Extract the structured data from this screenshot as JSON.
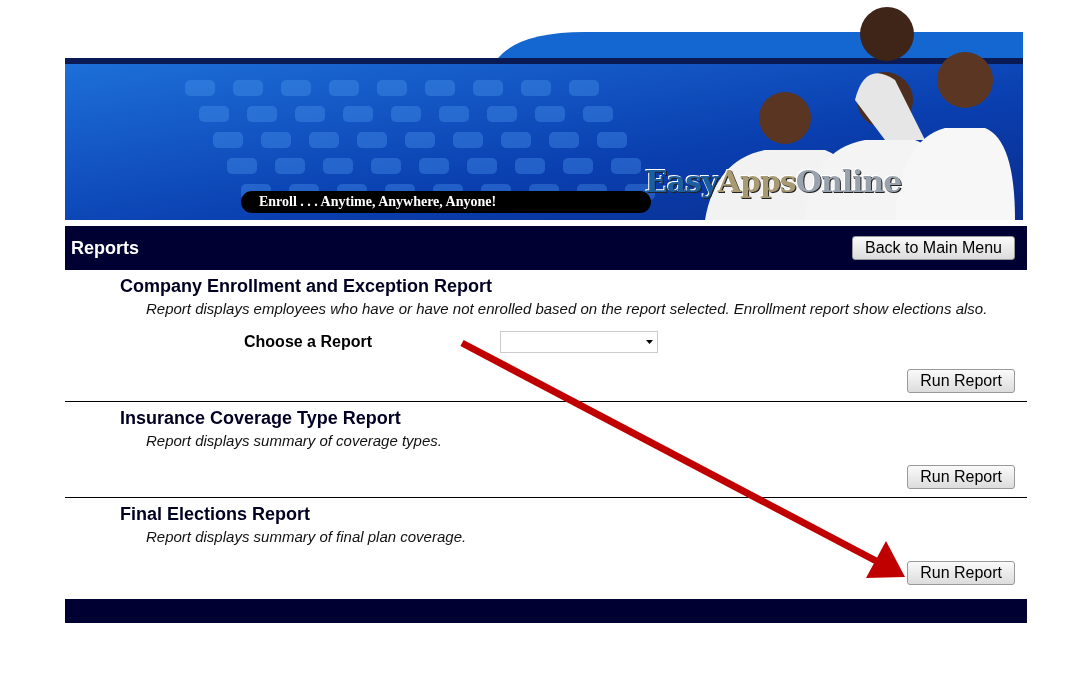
{
  "banner": {
    "tagline": "Enroll . . . Anytime, Anywhere, Anyone!",
    "logo": [
      {
        "text": "Easy",
        "color": "#1d5f9e"
      },
      {
        "text": "Apps",
        "color": "#a89a72"
      },
      {
        "text": "Online",
        "color": "#9aa3ad"
      }
    ]
  },
  "header": {
    "title": "Reports",
    "button": "Back to Main Menu"
  },
  "reports": [
    {
      "title": "Company Enrollment and Exception Report",
      "description": "Report displays employees who have or have not enrolled based on the report selected. Enrollment report show elections also.",
      "fields": [
        {
          "kind": "select",
          "label": "Choose a Report"
        }
      ],
      "button": "Run Report"
    },
    {
      "title": "Insurance Coverage Type Report",
      "description": "Report displays summary of coverage types.",
      "button": "Run Report"
    },
    {
      "title": "Final Elections Report",
      "description": "Report displays summary of final plan coverage.",
      "button": "Run Report"
    }
  ]
}
